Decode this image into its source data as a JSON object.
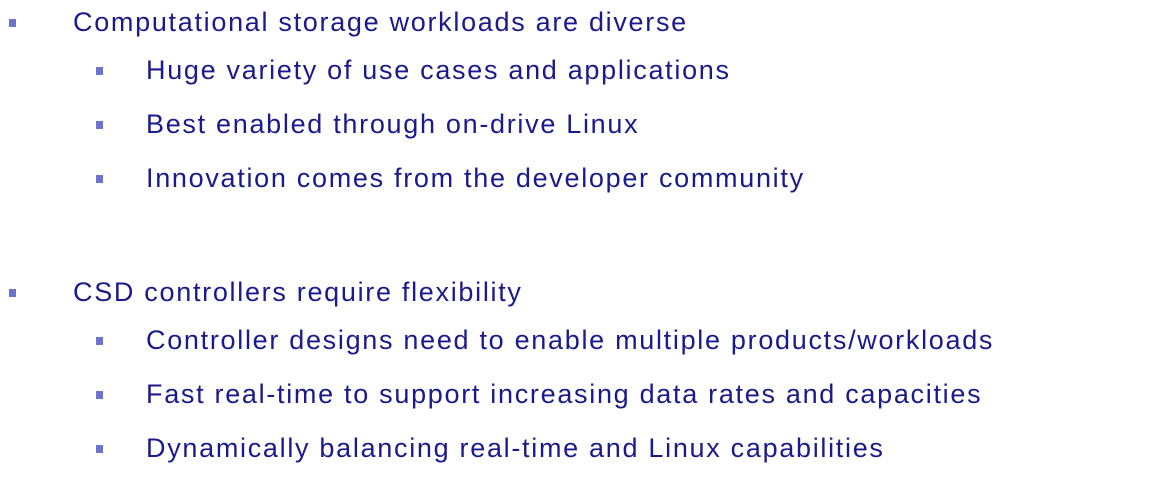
{
  "sections": [
    {
      "heading": "Computational storage workloads are diverse",
      "items": [
        "Huge variety of use cases and applications",
        "Best enabled through on-drive Linux",
        "Innovation comes from the developer community"
      ]
    },
    {
      "heading": "CSD controllers require flexibility",
      "items": [
        "Controller designs need to enable multiple products/workloads",
        "Fast real-time to support increasing data rates and capacities",
        "Dynamically balancing real-time and Linux capabilities"
      ]
    }
  ],
  "colors": {
    "text": "#1a1a8c",
    "bullet": "#6b73cc",
    "background": "#ffffff"
  }
}
